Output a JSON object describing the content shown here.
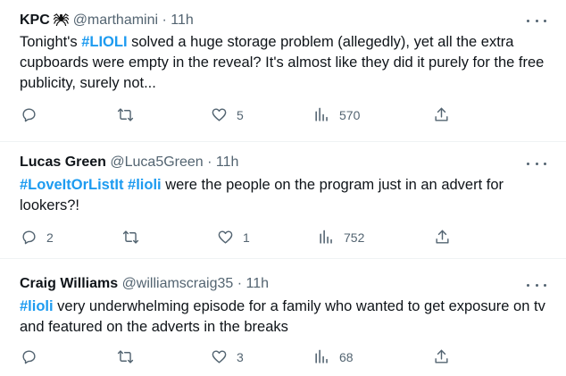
{
  "tweets": [
    {
      "name": "KPC",
      "name_icon": "spider-emoji",
      "handle": "@marthamini",
      "time": "· 11h",
      "body_parts": [
        {
          "type": "text",
          "value": "Tonight's "
        },
        {
          "type": "hashtag",
          "value": "#LIOLI"
        },
        {
          "type": "text",
          "value": " solved a huge storage problem (allegedly), yet all the extra cupboards were empty in the reveal? It's almost like they did it purely for the free publicity, surely not..."
        }
      ],
      "reply_count": "",
      "retweet_count": "",
      "like_count": "5",
      "view_count": "570"
    },
    {
      "name": "Lucas Green",
      "handle": "@Luca5Green",
      "time": "· 11h",
      "body_parts": [
        {
          "type": "hashtag",
          "value": "#LoveItOrListIt"
        },
        {
          "type": "text",
          "value": " "
        },
        {
          "type": "hashtag",
          "value": "#lioli"
        },
        {
          "type": "text",
          "value": " were the people on the program just in an advert for lookers?!"
        }
      ],
      "reply_count": "2",
      "retweet_count": "",
      "like_count": "1",
      "view_count": "752"
    },
    {
      "name": "Craig Williams",
      "handle": "@williamscraig35",
      "time": "· 11h",
      "body_parts": [
        {
          "type": "hashtag",
          "value": "#lioli"
        },
        {
          "type": "text",
          "value": " very underwhelming episode for a family who wanted to get exposure on tv and featured on the adverts in the breaks"
        }
      ],
      "reply_count": "",
      "retweet_count": "",
      "like_count": "3",
      "view_count": "68"
    }
  ],
  "colors": {
    "hashtag": "#1d9bf0",
    "secondary_text": "#536471",
    "primary_text": "#0f1419",
    "divider": "#eff3f4"
  },
  "icons": [
    "reply-icon",
    "retweet-icon",
    "like-icon",
    "views-icon",
    "share-icon",
    "more-icon"
  ]
}
